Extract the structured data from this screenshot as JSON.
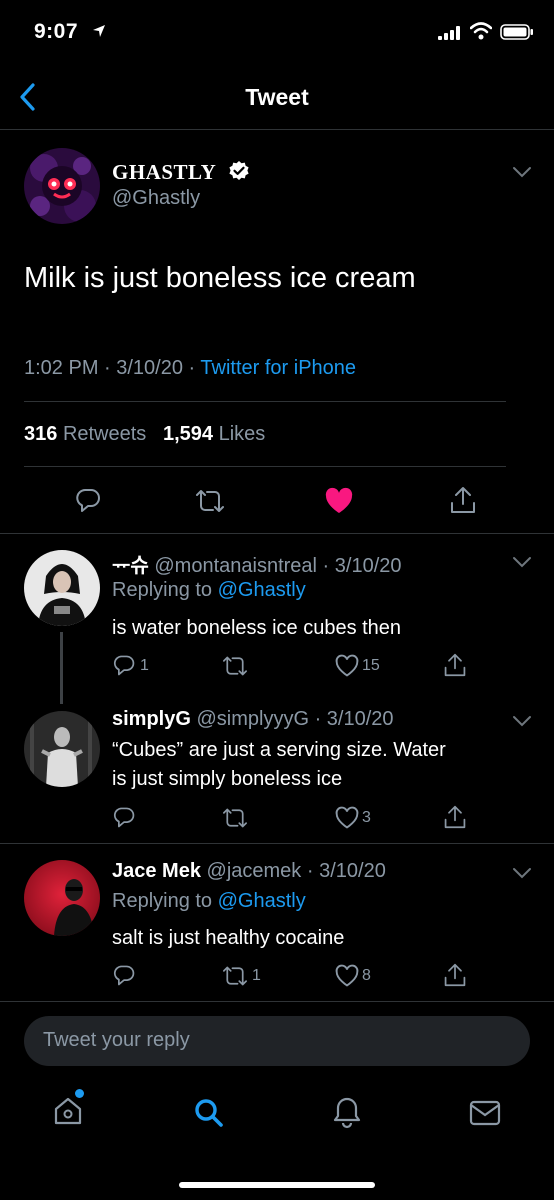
{
  "status_bar": {
    "time": "9:07"
  },
  "nav": {
    "title": "Tweet"
  },
  "tweet": {
    "author_name": "GHASTLY",
    "author_handle": "@Ghastly",
    "text": "Milk is just boneless ice cream",
    "time": "1:02 PM · 3/10/20 · ",
    "source": "Twitter for iPhone",
    "retweets_count": "316",
    "retweets_label": "Retweets",
    "likes_count": "1,594",
    "likes_label": "Likes"
  },
  "replies": [
    {
      "name": "ᅲ슈",
      "handle": "@montanaisntreal",
      "date": "· 3/10/20",
      "replying_label": "Replying to",
      "replying_to": "@Ghastly",
      "text": "is water boneless ice cubes then",
      "reply_count": "1",
      "retweet_count": "",
      "like_count": "15"
    },
    {
      "name": "simplyG",
      "handle": "@simplyyyG",
      "date": "· 3/10/20",
      "text_line1": "“Cubes” are just a serving size. Water",
      "text_line2": "is just simply boneless ice",
      "reply_count": "",
      "retweet_count": "",
      "like_count": "3"
    },
    {
      "name": "Jace Mek",
      "handle": "@jacemek",
      "date": "· 3/10/20",
      "replying_label": "Replying to",
      "replying_to": "@Ghastly",
      "text": "salt is just healthy cocaine",
      "reply_count": "",
      "retweet_count": "1",
      "like_count": "8"
    }
  ],
  "composer": {
    "placeholder": "Tweet your reply"
  },
  "tabbar": {
    "items": [
      "home-icon",
      "search-icon",
      "notifications-icon",
      "messages-icon"
    ],
    "active": "search-icon"
  },
  "colors": {
    "accent": "#1d9bf0",
    "like": "#f91880",
    "secondary_text": "#8b98a5",
    "divider": "#2f3336"
  }
}
